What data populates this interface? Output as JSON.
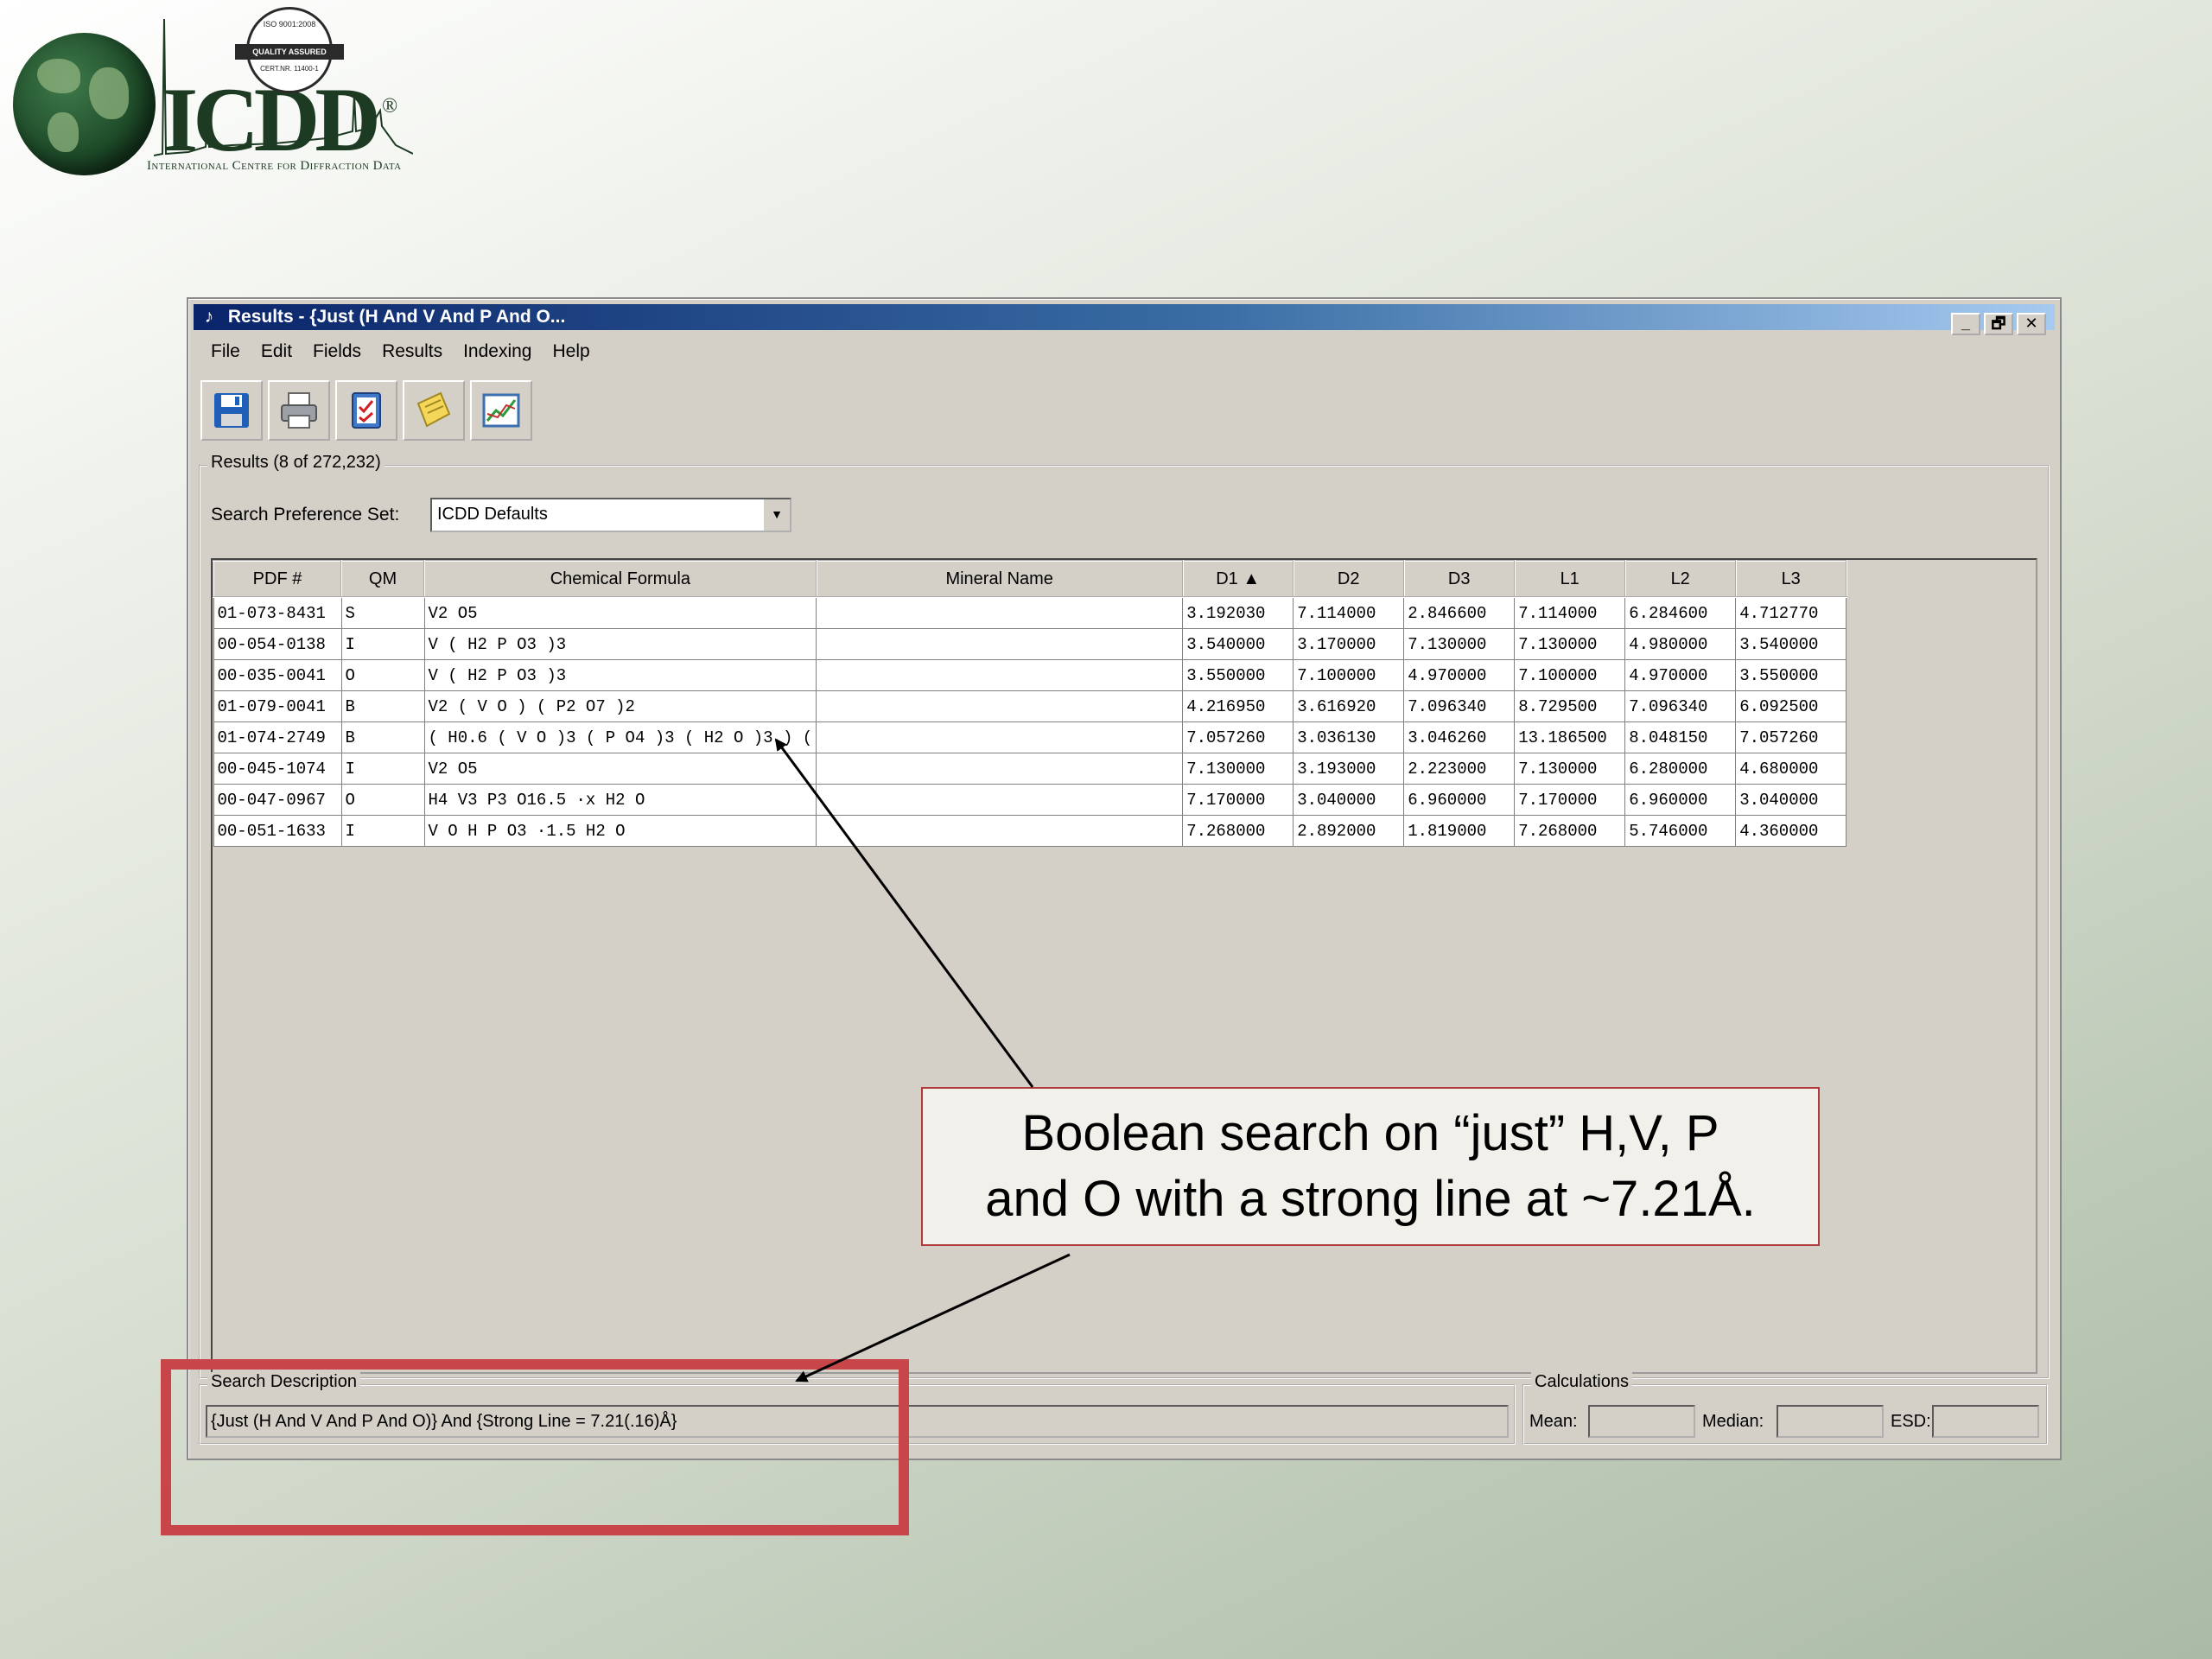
{
  "logo": {
    "text": "ICDD",
    "registered": "®",
    "subtitle": "International Centre for Diffraction Data",
    "iso_top": "ISO 9001:2008",
    "iso_band": "QUALITY ASSURED COMPANY",
    "iso_bottom": "CERT.NR. 11400-1"
  },
  "window": {
    "title": "Results - {Just (H And V And P And O...",
    "buttons": [
      "_",
      "🗗",
      "✕"
    ],
    "menu": [
      "File",
      "Edit",
      "Fields",
      "Results",
      "Indexing",
      "Help"
    ],
    "toolbar_icons": [
      "save-icon",
      "print-icon",
      "checklist-icon",
      "notes-icon",
      "graph-icon"
    ]
  },
  "results": {
    "legend": "Results (8 of 272,232)",
    "pref_label": "Search Preference Set:",
    "pref_value": "ICDD Defaults",
    "columns": [
      "PDF #",
      "QM",
      "Chemical Formula",
      "Mineral Name",
      "D1 ▲",
      "D2",
      "D3",
      "L1",
      "L2",
      "L3"
    ],
    "rows": [
      [
        "01-073-8431",
        "S",
        "V2 O5",
        "",
        "3.192030",
        "7.114000",
        "2.846600",
        "7.114000",
        "6.284600",
        "4.712770"
      ],
      [
        "00-054-0138",
        "I",
        "V ( H2 P O3 )3",
        "",
        "3.540000",
        "3.170000",
        "7.130000",
        "7.130000",
        "4.980000",
        "3.540000"
      ],
      [
        "00-035-0041",
        "O",
        "V ( H2 P O3 )3",
        "",
        "3.550000",
        "7.100000",
        "4.970000",
        "7.100000",
        "4.970000",
        "3.550000"
      ],
      [
        "01-079-0041",
        "B",
        "V2 ( V O ) ( P2 O7 )2",
        "",
        "4.216950",
        "3.616920",
        "7.096340",
        "8.729500",
        "7.096340",
        "6.092500"
      ],
      [
        "01-074-2749",
        "B",
        "( H0.6 ( V O )3 ( P O4 )3 ( H2 O )3 ) (",
        "",
        "7.057260",
        "3.036130",
        "3.046260",
        "13.186500",
        "8.048150",
        "7.057260"
      ],
      [
        "00-045-1074",
        "I",
        "V2 O5",
        "",
        "7.130000",
        "3.193000",
        "2.223000",
        "7.130000",
        "6.280000",
        "4.680000"
      ],
      [
        "00-047-0967",
        "O",
        "H4 V3 P3 O16.5 ·x H2 O",
        "",
        "7.170000",
        "3.040000",
        "6.960000",
        "7.170000",
        "6.960000",
        "3.040000"
      ],
      [
        "00-051-1633",
        "I",
        "V O H P O3 ·1.5 H2 O",
        "",
        "7.268000",
        "2.892000",
        "1.819000",
        "7.268000",
        "5.746000",
        "4.360000"
      ]
    ]
  },
  "search_description": {
    "legend": "Search Description",
    "value": "{Just (H And V And P And O)} And {Strong Line = 7.21(.16)Å}"
  },
  "calculations": {
    "legend": "Calculations",
    "mean_label": "Mean:",
    "median_label": "Median:",
    "esd_label": "ESD:"
  },
  "callout": {
    "line1": "Boolean search on “just” H,V, P",
    "line2": "and O with a strong line at ~7.21Å."
  },
  "colors": {
    "titlebar_start": "#0a246a",
    "titlebar_end": "#a6caf0",
    "window_face": "#d4d0c8",
    "highlight_red": "#c8454a"
  }
}
